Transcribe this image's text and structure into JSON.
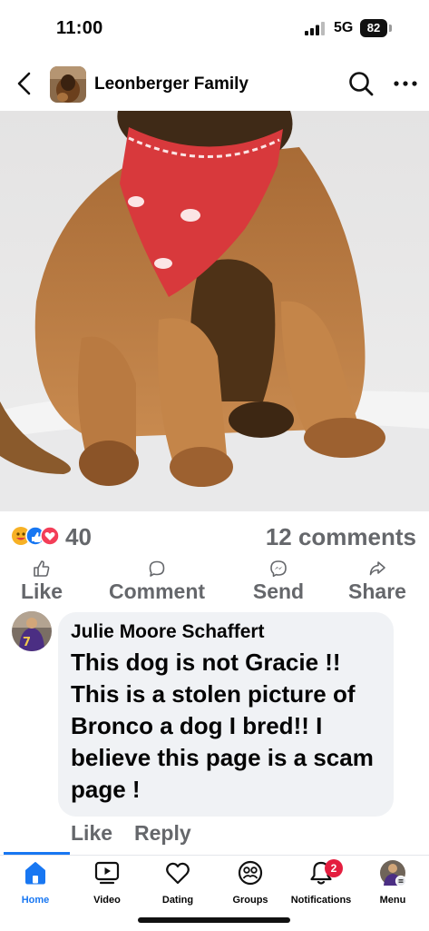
{
  "status_bar": {
    "time": "11:00",
    "network": "5G",
    "battery": "82"
  },
  "header": {
    "group_name": "Leonberger Family"
  },
  "post": {
    "reaction_count": "40",
    "comments_count": "12 comments",
    "actions": {
      "like": "Like",
      "comment": "Comment",
      "send": "Send",
      "share": "Share"
    }
  },
  "comment": {
    "author": "Julie Moore Schaffert",
    "text": "This dog is not Gracie !! This is a stolen picture of Bronco a dog I bred!! I believe this page is a scam page !",
    "like": "Like",
    "reply": "Reply"
  },
  "nav": {
    "home": "Home",
    "video": "Video",
    "dating": "Dating",
    "groups": "Groups",
    "notifications": "Notifications",
    "notifications_badge": "2",
    "menu": "Menu"
  },
  "colors": {
    "accent": "#1877f2",
    "secondary_text": "#65676b",
    "bubble": "#f0f2f5",
    "badge": "#e41e3f",
    "bandana": "#d8393c"
  },
  "icons": [
    "back-arrow-icon",
    "search-icon",
    "more-icon",
    "like-icon",
    "comment-icon",
    "messenger-icon",
    "share-icon",
    "home-icon",
    "video-icon",
    "dating-heart-icon",
    "groups-icon",
    "bell-icon"
  ]
}
